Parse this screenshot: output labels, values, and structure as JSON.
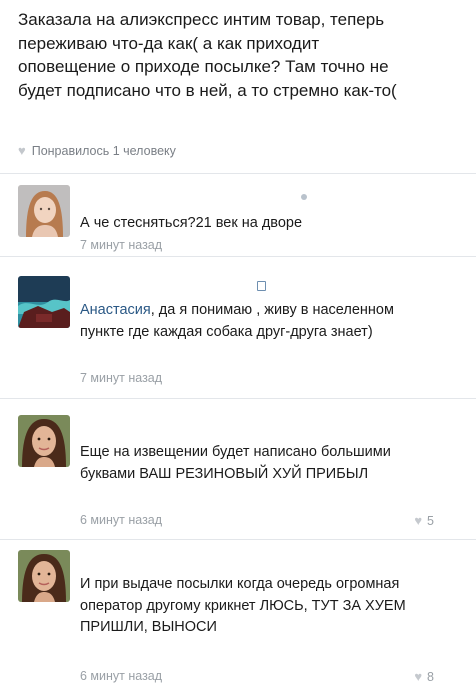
{
  "post": {
    "text": "Заказала на алиэкспресс интим товар, теперь переживаю что-да как( а как приходит оповещение о приходе посылке? Там точно не будет подписано что в ней, а то стремно как-то(",
    "likes_text": "Понравилось 1 человеку"
  },
  "comments": [
    {
      "text": "А че стесняться?21 век на дворе",
      "time": "7 минут назад",
      "likes": ""
    },
    {
      "name": "Анастасия",
      "text_rest": ", да я понимаю , живу в населенном пункте где каждая собака друг-друга знает)",
      "time": "7 минут назад",
      "likes": ""
    },
    {
      "text": "Еще на извещении будет написано большими буквами ВАШ РЕЗИНОВЫЙ ХУЙ ПРИБЫЛ",
      "time": "6 минут назад",
      "likes": "5"
    },
    {
      "text": "И при выдаче посылки когда очередь огромная оператор другому крикнет ЛЮСЬ, ТУТ ЗА ХУЕМ ПРИШЛИ, ВЫНОСИ",
      "time": "6 минут назад",
      "likes": "8"
    }
  ],
  "colors": {
    "link": "#2a5885",
    "meta": "#9aa0a6",
    "divider": "#e3e6ea"
  }
}
